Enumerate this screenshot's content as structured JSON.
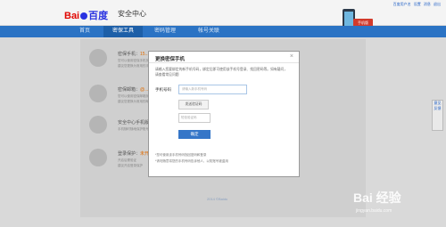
{
  "header": {
    "logo_text_left": "Bai",
    "logo_text_right": "百度",
    "title": "安全中心",
    "links": [
      "百度用户名",
      "设置",
      "消息",
      "退出"
    ],
    "promo_tag": "手机版"
  },
  "nav": {
    "tabs": [
      "首页",
      "密保工具",
      "密码管理",
      "帐号关联"
    ],
    "active_index": 1
  },
  "background_items": [
    {
      "title": "密保手机：",
      "title_value": "15...",
      "sub1": "您可以使用密保手机找回密码",
      "sub2": "建议您更换为常用的手机"
    },
    {
      "title": "密保邮箱：",
      "title_value": "@...",
      "sub1": "您可以使用密保邮箱找回密码",
      "sub2": "建议您更换为常用的邮箱"
    },
    {
      "title": "安全中心手机版",
      "title_value": "",
      "sub1": "手机随时随地保护账号",
      "sub2": ""
    },
    {
      "title": "登录保护：",
      "title_value": "未开启",
      "sub1": "开启后需验证",
      "sub2": "建议开启登录保护"
    }
  ],
  "footer": {
    "copyright": "2014 ©Baidu"
  },
  "modal": {
    "title": "更换密保手机",
    "close_label": "×",
    "description": "请输入您要绑定的新手机号码，绑定后即可使用该手机号登录、找回密码等。如有疑问，请查看常见问题",
    "phone_label": "手机号码",
    "phone_placeholder": "请输入新手机号码",
    "send_code_label": "发送验证码",
    "code_placeholder": "短信验证码",
    "confirm_label": "确定",
    "notes": [
      "*您可使用该手机号码找回密码和登录",
      "*请勿随意将您的手机号码告诉他人，以防账号被盗用"
    ]
  },
  "side_tab": {
    "label": "意见反馈"
  },
  "watermark": {
    "brand": "Bai 经验",
    "url": "jingyan.baidu.com"
  },
  "colors": {
    "nav_bg": "#2b73c4",
    "nav_active": "#1d5fa8",
    "confirm_btn": "#3576c8",
    "brand_red": "#e10601",
    "brand_blue": "#2932e1"
  }
}
